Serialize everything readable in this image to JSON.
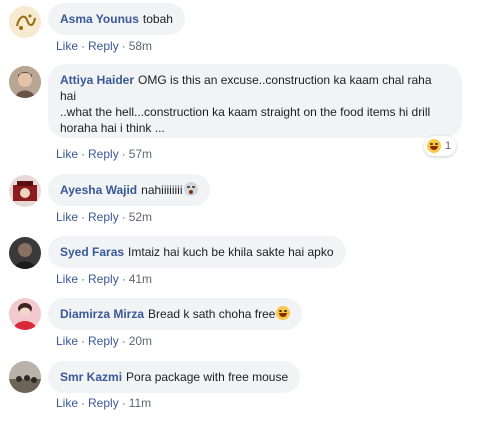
{
  "actions": {
    "like": "Like",
    "reply": "Reply",
    "dot": "·"
  },
  "comments": [
    {
      "name": "Asma Younus",
      "text": "tobah",
      "time": "58m"
    },
    {
      "name": "Attiya Haider",
      "text": "OMG is this an excuse..construction ka kaam chal raha hai",
      "text2": "..what the hell...construction ka kaam straight on the food items hi drill horaha hai i think ...",
      "time": "57m",
      "reaction_count": "1",
      "reaction_icon": "laugh-emoji-icon"
    },
    {
      "name": "Ayesha Wajid",
      "text": "nahiiiiiiii",
      "time": "52m",
      "emoji_icon": "scream-emoji-icon"
    },
    {
      "name": "Syed Faras",
      "text": "Imtaiz hai kuch be khila sakte hai apko",
      "time": "41m"
    },
    {
      "name": "Diamirza Mirza",
      "text": "Bread k sath choha free",
      "time": "20m",
      "emoji_icon": "laugh-emoji-icon"
    },
    {
      "name": "Smr Kazmi",
      "text": "Pora package with free mouse",
      "time": "11m"
    }
  ],
  "colors": {
    "name": "#385898",
    "bubble": "#f2f3f5",
    "meta": "#606770"
  }
}
